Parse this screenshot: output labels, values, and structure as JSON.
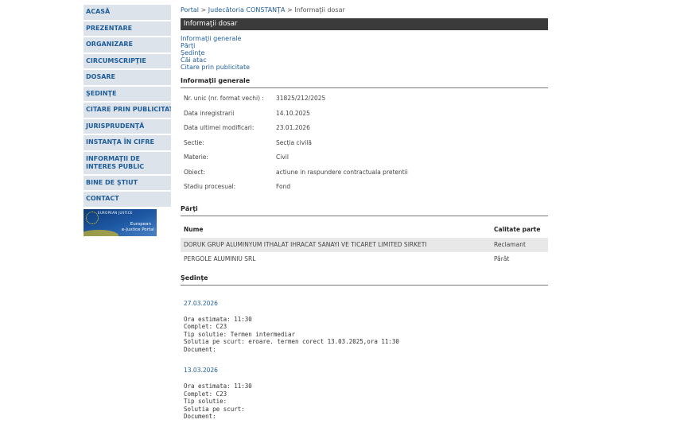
{
  "sidebar": {
    "items": [
      {
        "label": "ACASĂ"
      },
      {
        "label": "PREZENTARE"
      },
      {
        "label": "ORGANIZARE"
      },
      {
        "label": "CIRCUMSCRIPŢIE"
      },
      {
        "label": "DOSARE"
      },
      {
        "label": "ŞEDINŢE"
      },
      {
        "label": "CITARE PRIN PUBLICITATE"
      },
      {
        "label": "JURISPRUDENŢĂ"
      },
      {
        "label": "INSTANŢA ÎN CIFRE"
      },
      {
        "label": "INFORMAŢII DE INTERES PUBLIC"
      },
      {
        "label": "BINE DE ŞTIUT"
      },
      {
        "label": "CONTACT"
      }
    ],
    "logo": {
      "tag": "EUROPEAN JUSTICE",
      "line1": "European",
      "line2": "e-Justice Portal"
    }
  },
  "breadcrumb": {
    "portal": "Portal",
    "sep1": " > ",
    "court": "Judecătoria CONSTANŢA",
    "sep2": " > ",
    "current": "Informaţii dosar"
  },
  "header": {
    "title": "Informaţii dosar"
  },
  "section_links": [
    "Informaţii generale",
    "Părţi",
    "Şedinţe",
    "Căi atac",
    "Citare prin publicitate"
  ],
  "general": {
    "title": "Informaţii generale",
    "rows": [
      {
        "label": "Nr. unic (nr. format vechi) :",
        "value": "31825/212/2025"
      },
      {
        "label": "Data inregistrarii",
        "value": "14.10.2025"
      },
      {
        "label": "Data ultimei modificari:",
        "value": "23.01.2026"
      },
      {
        "label": "Sectie:",
        "value": "Secția civilă"
      },
      {
        "label": "Materie:",
        "value": "Civil"
      },
      {
        "label": "Obiect:",
        "value": "actiune in raspundere contractuala pretentii"
      },
      {
        "label": "Stadiu procesual:",
        "value": "Fond"
      }
    ]
  },
  "parti": {
    "title": "Părţi",
    "col_name": "Nume",
    "col_role": "Calitate parte",
    "rows": [
      {
        "name": "DORUK GRUP ALUMINYUM ITHALAT IHRACAT SANAYI VE TICARET LIMITED SIRKETI",
        "role": "Reclamant"
      },
      {
        "name": "PERGOLE ALUMINIU SRL",
        "role": "Pârât"
      }
    ]
  },
  "sedinte": {
    "title": "Şedinţe",
    "items": [
      {
        "date": "27.03.2026",
        "lines": [
          "Ora estimata: 11:30",
          "Complet: C23",
          "Tip solutie: Termen intermediar",
          "Solutia pe scurt: eroare. termen corect 13.03.2025,ora 11:30",
          "Document:"
        ]
      },
      {
        "date": "13.03.2026",
        "lines": [
          "Ora estimata: 11:30",
          "Complet: C23",
          "Tip solutie:",
          "Solutia pe scurt:",
          "Document:"
        ]
      }
    ]
  }
}
